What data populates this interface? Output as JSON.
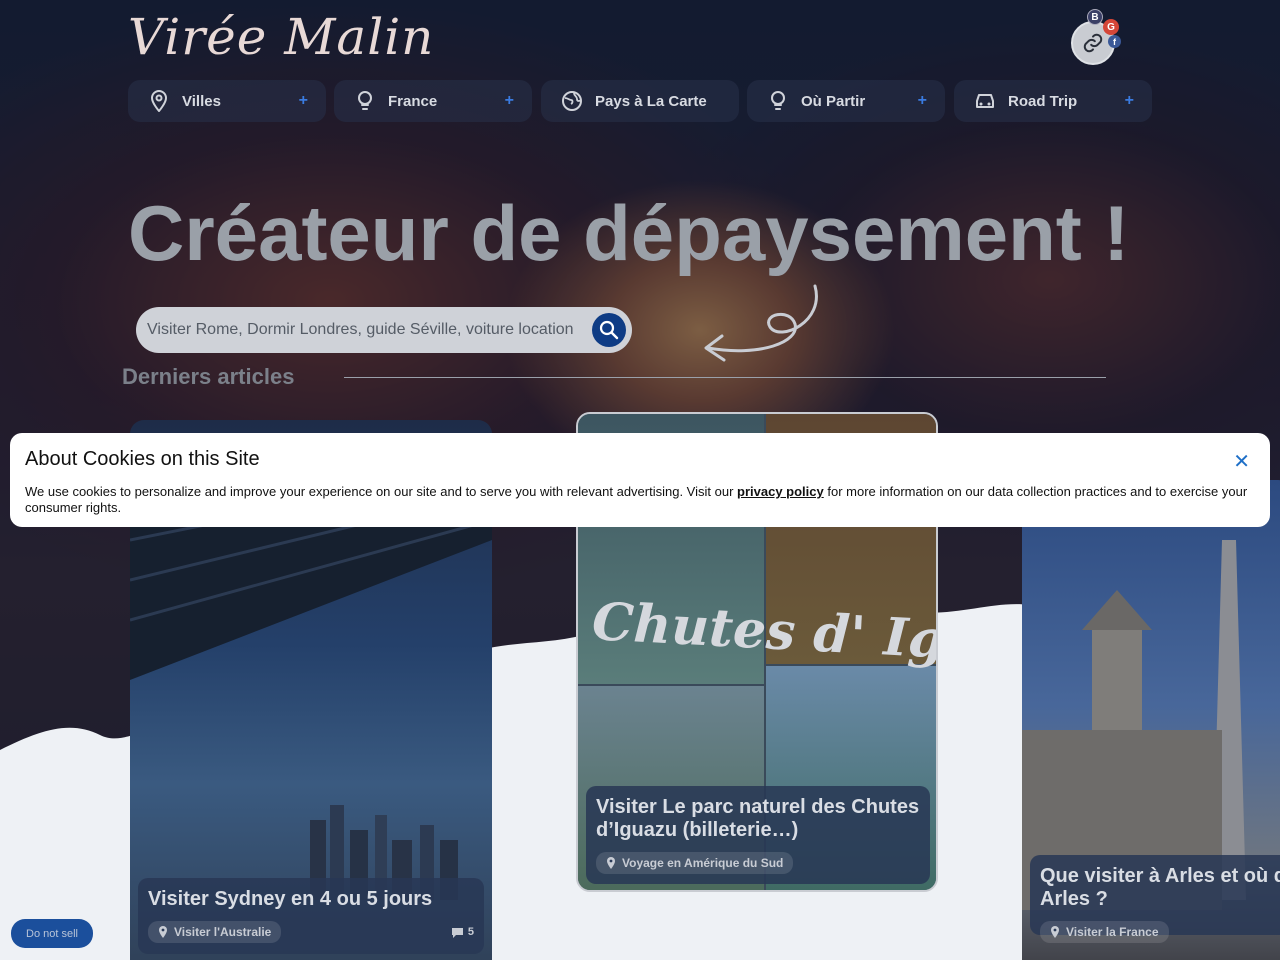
{
  "header": {
    "logo_text": "Virée Malin",
    "share_icons": [
      "B",
      "G",
      "f"
    ]
  },
  "nav": {
    "items": [
      {
        "label": "Villes",
        "icon": "map-pin-icon",
        "has_plus": true
      },
      {
        "label": "France",
        "icon": "bulb-pin-icon",
        "has_plus": true
      },
      {
        "label": "Pays à La Carte",
        "icon": "globe-icon",
        "has_plus": false
      },
      {
        "label": "Où Partir",
        "icon": "bulb-pin-icon",
        "has_plus": true
      },
      {
        "label": "Road Trip",
        "icon": "car-icon",
        "has_plus": true
      }
    ],
    "plus_symbol": "+"
  },
  "hero": {
    "headline": "Créateur de dépaysement !",
    "search_placeholder": "Visiter Rome, Dormir Londres, guide Séville, voiture location"
  },
  "articles": {
    "section_title": "Derniers articles",
    "cards": [
      {
        "title": "Visiter Sydney en 4 ou 5 jours",
        "category": "Visiter l'Australie",
        "comments": "5"
      },
      {
        "title": "Visiter Le parc naturel des Chutes d’Iguazu (billeterie…)",
        "category": "Voyage en Amérique du Sud",
        "image_text": "Chutes d' Iguazu"
      },
      {
        "title": "Que visiter à Arles et où d Arles ?",
        "category": "Visiter la France"
      }
    ]
  },
  "cookie_banner": {
    "title": "About Cookies on this Site",
    "text_before": "We use cookies to personalize and improve your experience on our site and to serve you with relevant advertising. Visit our ",
    "link": "privacy policy",
    "text_after": " for more information on our data collection practices and to exercise your consumer rights.",
    "close": "✕"
  },
  "do_not_sell": "Do not sell"
}
